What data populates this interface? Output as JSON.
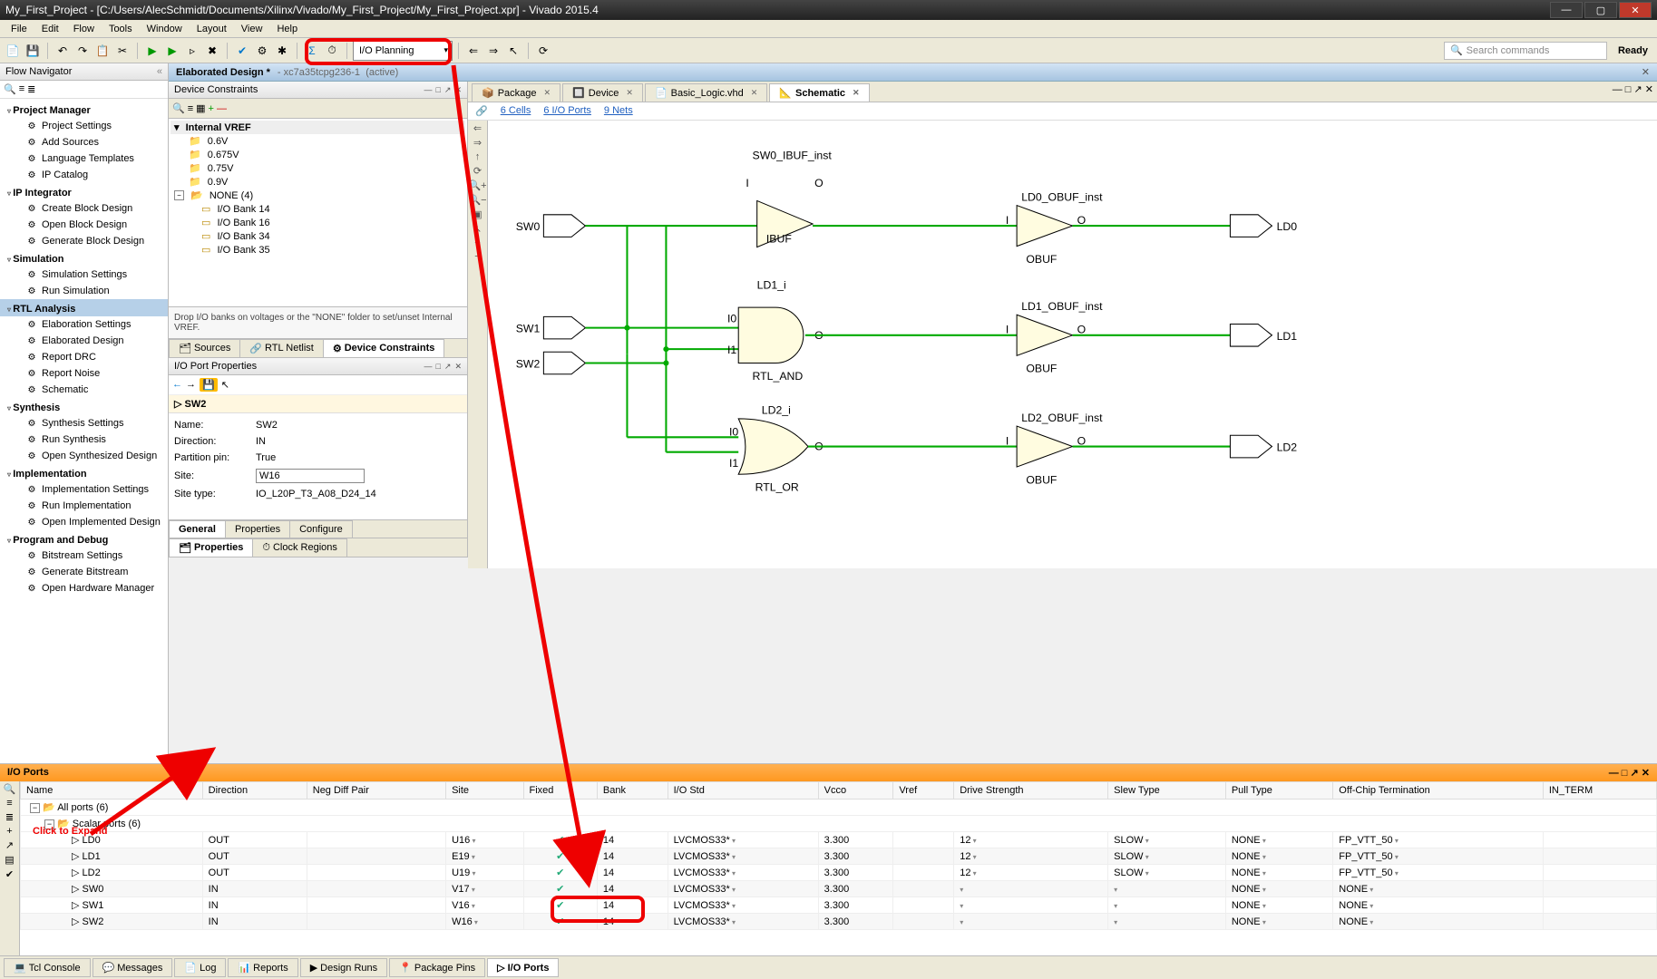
{
  "window": {
    "title": "My_First_Project - [C:/Users/AlecSchmidt/Documents/Xilinx/Vivado/My_First_Project/My_First_Project.xpr] - Vivado 2015.4"
  },
  "menu": [
    "File",
    "Edit",
    "Flow",
    "Tools",
    "Window",
    "Layout",
    "View",
    "Help"
  ],
  "toolbar": {
    "layout_dropdown": "I/O Planning",
    "search_placeholder": "Search commands",
    "status": "Ready"
  },
  "flow_nav": {
    "title": "Flow Navigator",
    "sections": [
      {
        "name": "Project Manager",
        "items": [
          "Project Settings",
          "Add Sources",
          "Language Templates",
          "IP Catalog"
        ]
      },
      {
        "name": "IP Integrator",
        "items": [
          "Create Block Design",
          "Open Block Design",
          "Generate Block Design"
        ]
      },
      {
        "name": "Simulation",
        "items": [
          "Simulation Settings",
          "Run Simulation"
        ]
      },
      {
        "name": "RTL Analysis",
        "hl": true,
        "items": [
          "Elaboration Settings",
          "Elaborated Design",
          "Report DRC",
          "Report Noise",
          "Schematic"
        ]
      },
      {
        "name": "Synthesis",
        "items": [
          "Synthesis Settings",
          "Run Synthesis",
          "Open Synthesized Design"
        ]
      },
      {
        "name": "Implementation",
        "items": [
          "Implementation Settings",
          "Run Implementation",
          "Open Implemented Design"
        ]
      },
      {
        "name": "Program and Debug",
        "items": [
          "Bitstream Settings",
          "Generate Bitstream",
          "Open Hardware Manager"
        ]
      }
    ]
  },
  "elaborated": {
    "title": "Elaborated Design *",
    "part": "xc7a35tcpg236-1",
    "state": "(active)"
  },
  "device_constraints": {
    "title": "Device Constraints",
    "root": "Internal VREF",
    "voltages": [
      "0.6V",
      "0.675V",
      "0.75V",
      "0.9V"
    ],
    "none_label": "NONE (4)",
    "none_items": [
      "I/O Bank 14",
      "I/O Bank 16",
      "I/O Bank 34",
      "I/O Bank 35"
    ],
    "hint": "Drop I/O banks on voltages or the \"NONE\" folder to set/unset Internal VREF.",
    "tabs": [
      "Sources",
      "RTL Netlist",
      "Device Constraints"
    ]
  },
  "port_props": {
    "title": "I/O Port Properties",
    "port": "SW2",
    "rows": [
      {
        "k": "Name:",
        "v": "SW2"
      },
      {
        "k": "Direction:",
        "v": "IN"
      },
      {
        "k": "Partition pin:",
        "v": "True"
      },
      {
        "k": "Site:",
        "v": "W16",
        "input": true
      },
      {
        "k": "Site type:",
        "v": "IO_L20P_T3_A08_D24_14"
      }
    ],
    "tabs": [
      "General",
      "Properties",
      "Configure"
    ],
    "bottom_tabs": [
      "Properties",
      "Clock Regions"
    ]
  },
  "editor_tabs": [
    {
      "label": "Package",
      "close": true
    },
    {
      "label": "Device",
      "close": true
    },
    {
      "label": "Basic_Logic.vhd",
      "close": true
    },
    {
      "label": "Schematic",
      "close": true,
      "active": true
    }
  ],
  "schematic_links": [
    "6 Cells",
    "6 I/O Ports",
    "9 Nets"
  ],
  "schematic": {
    "inputs": [
      "SW0",
      "SW1",
      "SW2"
    ],
    "outputs": [
      "LD0",
      "LD1",
      "LD2"
    ],
    "gates": [
      {
        "name": "SW0_IBUF_inst",
        "type": "IBUF"
      },
      {
        "name": "LD1_i",
        "type": "RTL_AND"
      },
      {
        "name": "LD2_i",
        "type": "RTL_OR"
      },
      {
        "name": "LD0_OBUF_inst",
        "type": "OBUF"
      },
      {
        "name": "LD1_OBUF_inst",
        "type": "OBUF"
      },
      {
        "name": "LD2_OBUF_inst",
        "type": "OBUF"
      }
    ]
  },
  "ioports": {
    "title": "I/O Ports",
    "columns": [
      "Name",
      "Direction",
      "Neg Diff Pair",
      "Site",
      "Fixed",
      "Bank",
      "I/O Std",
      "Vcco",
      "Vref",
      "Drive Strength",
      "Slew Type",
      "Pull Type",
      "Off-Chip Termination",
      "IN_TERM"
    ],
    "groups": [
      {
        "label": "All ports (6)"
      },
      {
        "label": "Scalar ports (6)"
      }
    ],
    "rows": [
      {
        "name": "LD0",
        "dir": "OUT",
        "site": "U16",
        "fixed": true,
        "bank": "14",
        "std": "LVCMOS33*",
        "vcco": "3.300",
        "drive": "12",
        "slew": "SLOW",
        "pull": "NONE",
        "term": "FP_VTT_50"
      },
      {
        "name": "LD1",
        "dir": "OUT",
        "site": "E19",
        "fixed": true,
        "bank": "14",
        "std": "LVCMOS33*",
        "vcco": "3.300",
        "drive": "12",
        "slew": "SLOW",
        "pull": "NONE",
        "term": "FP_VTT_50"
      },
      {
        "name": "LD2",
        "dir": "OUT",
        "site": "U19",
        "fixed": true,
        "bank": "14",
        "std": "LVCMOS33*",
        "vcco": "3.300",
        "drive": "12",
        "slew": "SLOW",
        "pull": "NONE",
        "term": "FP_VTT_50"
      },
      {
        "name": "SW0",
        "dir": "IN",
        "site": "V17",
        "fixed": true,
        "bank": "14",
        "std": "LVCMOS33*",
        "vcco": "3.300",
        "drive": "",
        "slew": "",
        "pull": "NONE",
        "term": "NONE"
      },
      {
        "name": "SW1",
        "dir": "IN",
        "site": "V16",
        "fixed": true,
        "bank": "14",
        "std": "LVCMOS33*",
        "vcco": "3.300",
        "drive": "",
        "slew": "",
        "pull": "NONE",
        "term": "NONE"
      },
      {
        "name": "SW2",
        "dir": "IN",
        "site": "W16",
        "fixed": true,
        "bank": "14",
        "std": "LVCMOS33*",
        "vcco": "3.300",
        "drive": "",
        "slew": "",
        "pull": "NONE",
        "term": "NONE"
      }
    ]
  },
  "bottom_tabs": [
    "Tcl Console",
    "Messages",
    "Log",
    "Reports",
    "Design Runs",
    "Package Pins",
    "I/O Ports"
  ],
  "annotations": {
    "click_expand": "Click to Expand"
  }
}
